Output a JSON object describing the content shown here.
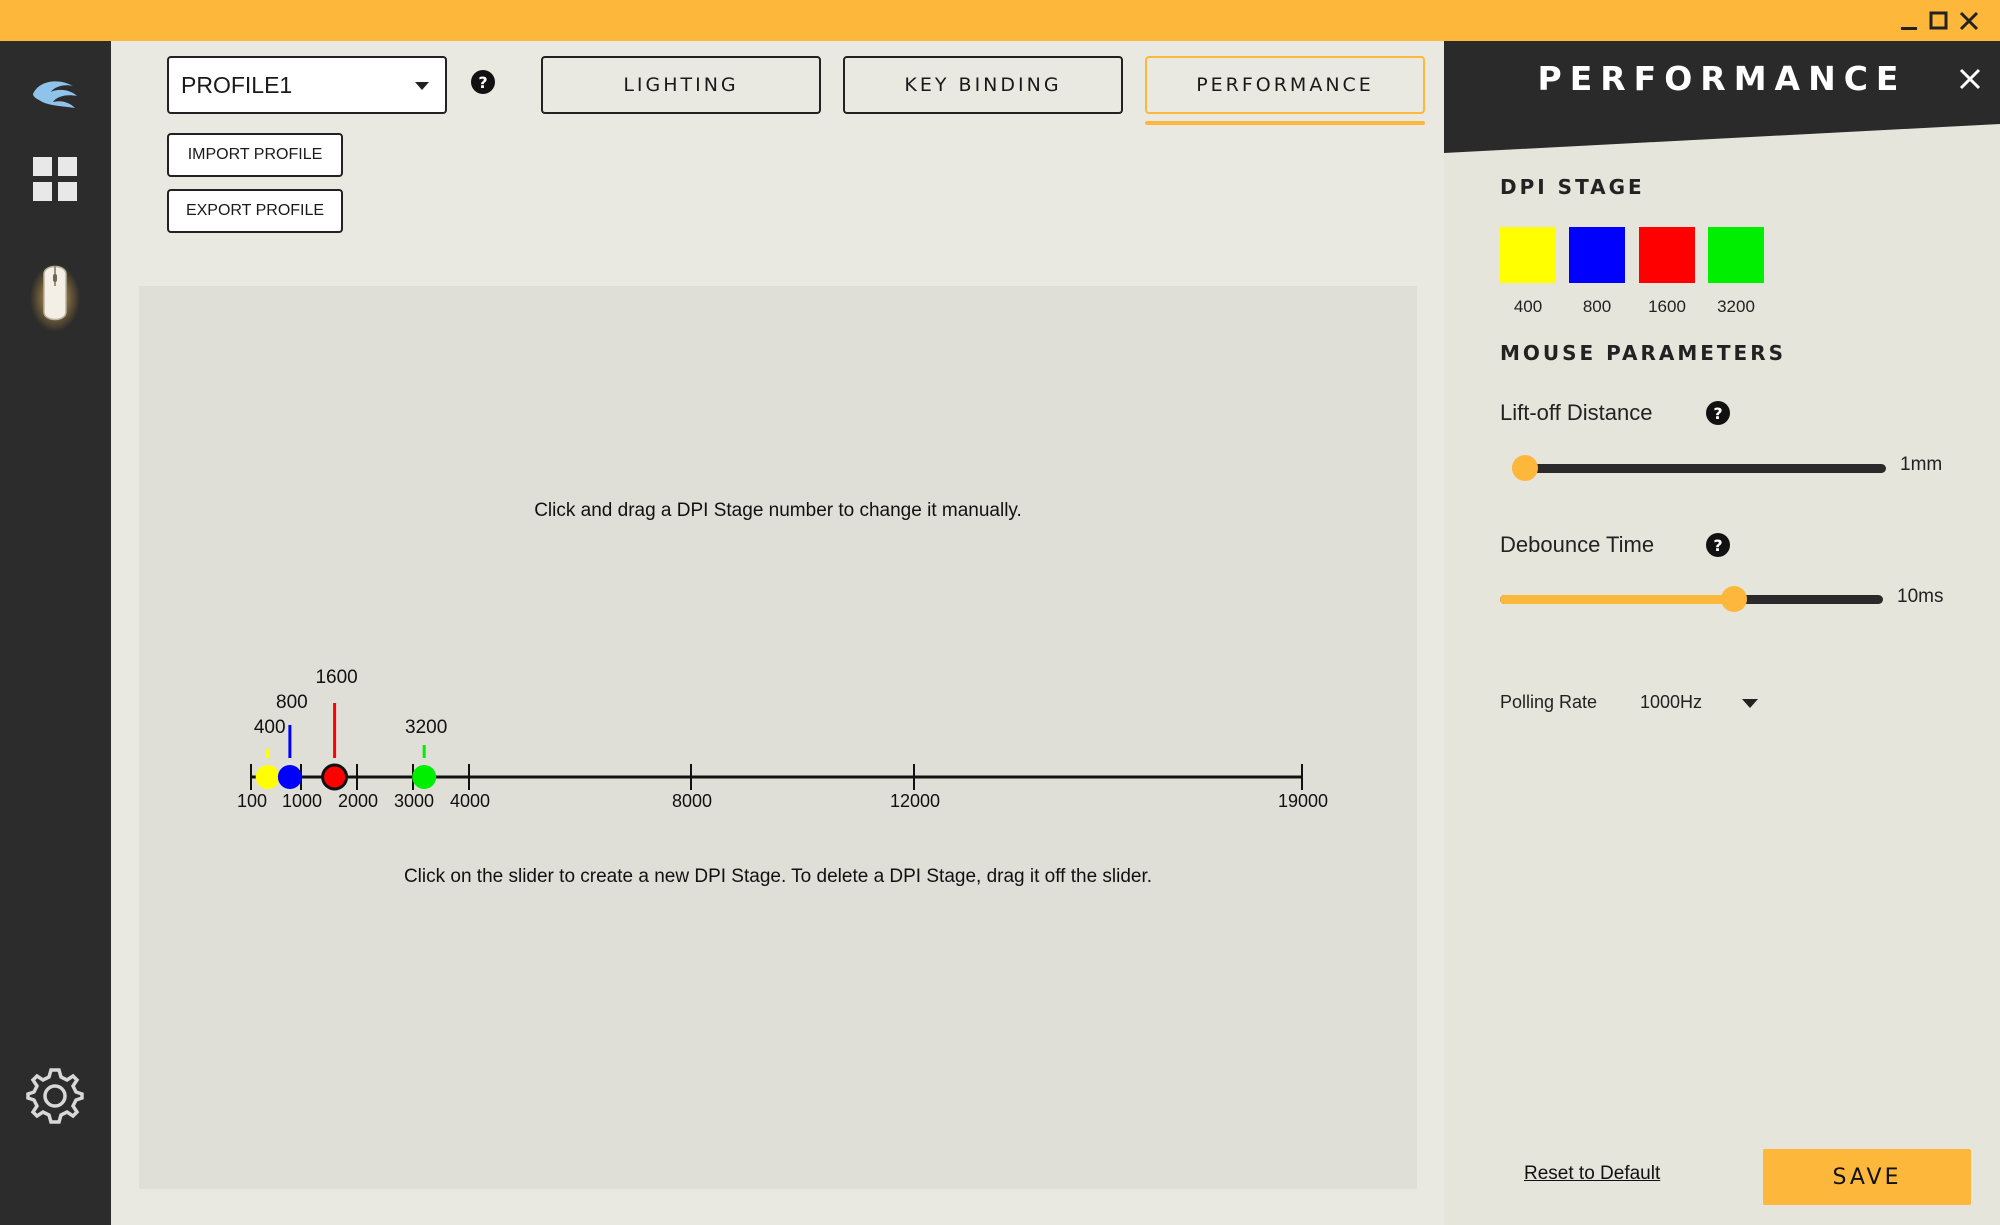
{
  "profile": {
    "selected": "PROFILE1"
  },
  "tabs": [
    {
      "label": "LIGHTING",
      "active": false
    },
    {
      "label": "KEY BINDING",
      "active": false
    },
    {
      "label": "PERFORMANCE",
      "active": true
    }
  ],
  "buttons": {
    "import": "IMPORT PROFILE",
    "export": "EXPORT PROFILE"
  },
  "dpi_editor": {
    "hint_top": "Click and drag a DPI Stage number to change it manually.",
    "hint_bottom": "Click on the slider to create a new DPI Stage. To delete a DPI Stage, drag it off the slider.",
    "scale_ticks": [
      "100",
      "1000",
      "2000",
      "3000",
      "4000",
      "8000",
      "12000",
      "19000"
    ],
    "stages": [
      {
        "label": "400",
        "value": 400,
        "color": "#ffff00"
      },
      {
        "label": "800",
        "value": 800,
        "color": "#0000ff"
      },
      {
        "label": "1600",
        "value": 1600,
        "color": "#ff0000"
      },
      {
        "label": "3200",
        "value": 3200,
        "color": "#00ee00"
      }
    ],
    "selected_stage": "1600"
  },
  "sidebar": {
    "title": "PERFORMANCE",
    "dpi_stage_title": "DPI STAGE",
    "swatches": [
      {
        "label": "400",
        "color": "#ffff00"
      },
      {
        "label": "800",
        "color": "#0000ff"
      },
      {
        "label": "1600",
        "color": "#ff0000"
      },
      {
        "label": "3200",
        "color": "#00ee00"
      }
    ],
    "mouse_params_title": "MOUSE PARAMETERS",
    "liftoff": {
      "label": "Lift-off Distance",
      "value": "1mm",
      "level": 0.0
    },
    "debounce": {
      "label": "Debounce Time",
      "value": "10ms",
      "level": 0.61
    },
    "polling": {
      "label": "Polling Rate",
      "value": "1000Hz"
    },
    "reset_label": "Reset to Default",
    "save_label": "SAVE"
  },
  "colors": {
    "accent": "#fdb73b",
    "rail": "#2c2c2c",
    "header": "#2a2a2a"
  }
}
